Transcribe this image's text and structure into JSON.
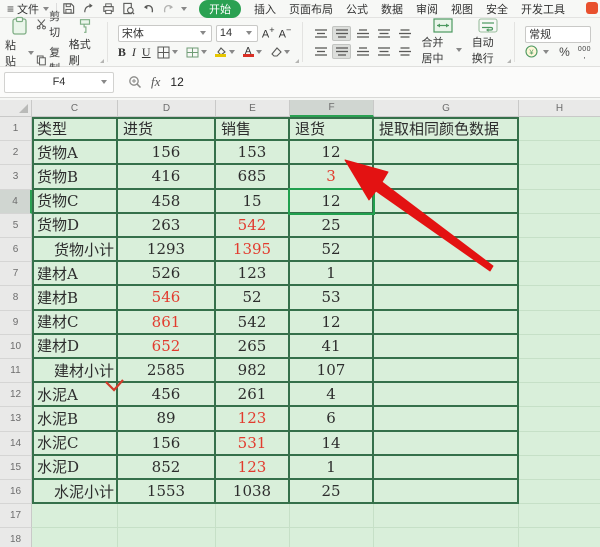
{
  "menu": {
    "file_label": "文件",
    "tabs": [
      {
        "label": "开始",
        "active": true
      },
      {
        "label": "插入",
        "active": false
      },
      {
        "label": "页面布局",
        "active": false
      },
      {
        "label": "公式",
        "active": false
      },
      {
        "label": "数据",
        "active": false
      },
      {
        "label": "审阅",
        "active": false
      },
      {
        "label": "视图",
        "active": false
      },
      {
        "label": "安全",
        "active": false
      },
      {
        "label": "开发工具",
        "active": false
      }
    ],
    "quick_icons": [
      "save-icon",
      "export-icon",
      "print-icon",
      "preview-icon",
      "undo-icon",
      "redo-icon"
    ]
  },
  "toolbar": {
    "paste_label": "粘贴",
    "cut_label": "剪切",
    "copy_label": "复制",
    "format_painter_label": "格式刷",
    "font_name": "宋体",
    "font_size": "14",
    "bold_label": "B",
    "italic_label": "I",
    "underline_label": "U",
    "font_bigger_label": "A",
    "font_smaller_label": "A",
    "font_color_label": "A",
    "merge_label": "合并居中",
    "wrap_label": "自动换行",
    "number_format_value": "常规",
    "percent_label": "%",
    "thousands_label": "000"
  },
  "formula_bar": {
    "name_box": "F4",
    "fx_label": "fx",
    "value": "12"
  },
  "sheet": {
    "column_labels": [
      "C",
      "D",
      "E",
      "F",
      "G",
      "H"
    ],
    "selected_column": "F",
    "selected_row": 4,
    "selected_cell": "F4",
    "rows": [
      {
        "n": 1,
        "c": [
          "类型",
          "进货",
          "销售",
          "退货",
          "提取相同颜色数据"
        ],
        "header": true,
        "red": [],
        "subtotal": false
      },
      {
        "n": 2,
        "c": [
          "货物A",
          "156",
          "153",
          "12",
          ""
        ],
        "red": [],
        "subtotal": false
      },
      {
        "n": 3,
        "c": [
          "货物B",
          "416",
          "685",
          "3",
          ""
        ],
        "red": [
          3
        ],
        "subtotal": false
      },
      {
        "n": 4,
        "c": [
          "货物C",
          "458",
          "15",
          "12",
          ""
        ],
        "red": [],
        "subtotal": false
      },
      {
        "n": 5,
        "c": [
          "货物D",
          "263",
          "542",
          "25",
          ""
        ],
        "red": [
          2
        ],
        "subtotal": false
      },
      {
        "n": 6,
        "c": [
          "货物小计",
          "1293",
          "1395",
          "52",
          ""
        ],
        "red": [
          2
        ],
        "subtotal": true
      },
      {
        "n": 7,
        "c": [
          "建材A",
          "526",
          "123",
          "1",
          ""
        ],
        "red": [],
        "subtotal": false
      },
      {
        "n": 8,
        "c": [
          "建材B",
          "546",
          "52",
          "53",
          ""
        ],
        "red": [
          1
        ],
        "subtotal": false
      },
      {
        "n": 9,
        "c": [
          "建材C",
          "861",
          "542",
          "12",
          ""
        ],
        "red": [
          1
        ],
        "subtotal": false
      },
      {
        "n": 10,
        "c": [
          "建材D",
          "652",
          "265",
          "41",
          ""
        ],
        "red": [
          1
        ],
        "subtotal": false
      },
      {
        "n": 11,
        "c": [
          "建材小计",
          "2585",
          "982",
          "107",
          ""
        ],
        "red": [],
        "subtotal": true
      },
      {
        "n": 12,
        "c": [
          "水泥A",
          "456",
          "261",
          "4",
          ""
        ],
        "red": [],
        "subtotal": false
      },
      {
        "n": 13,
        "c": [
          "水泥B",
          "89",
          "123",
          "6",
          ""
        ],
        "red": [
          2
        ],
        "subtotal": false
      },
      {
        "n": 14,
        "c": [
          "水泥C",
          "156",
          "531",
          "14",
          ""
        ],
        "red": [
          2
        ],
        "subtotal": false
      },
      {
        "n": 15,
        "c": [
          "水泥D",
          "852",
          "123",
          "1",
          ""
        ],
        "red": [
          2
        ],
        "subtotal": false
      },
      {
        "n": 16,
        "c": [
          "水泥小计",
          "1553",
          "1038",
          "25",
          ""
        ],
        "red": [],
        "subtotal": true
      },
      {
        "n": 17,
        "c": [
          "",
          "",
          "",
          "",
          ""
        ],
        "red": [],
        "subtotal": false
      },
      {
        "n": 18,
        "c": [
          "",
          "",
          "",
          "",
          ""
        ],
        "red": [],
        "subtotal": false
      }
    ]
  },
  "colors": {
    "accent_green": "#2aa152",
    "sheet_fill": "#d9efda",
    "table_border": "#35704a",
    "red_text": "#e23b2e",
    "arrow_red": "#e31212"
  }
}
